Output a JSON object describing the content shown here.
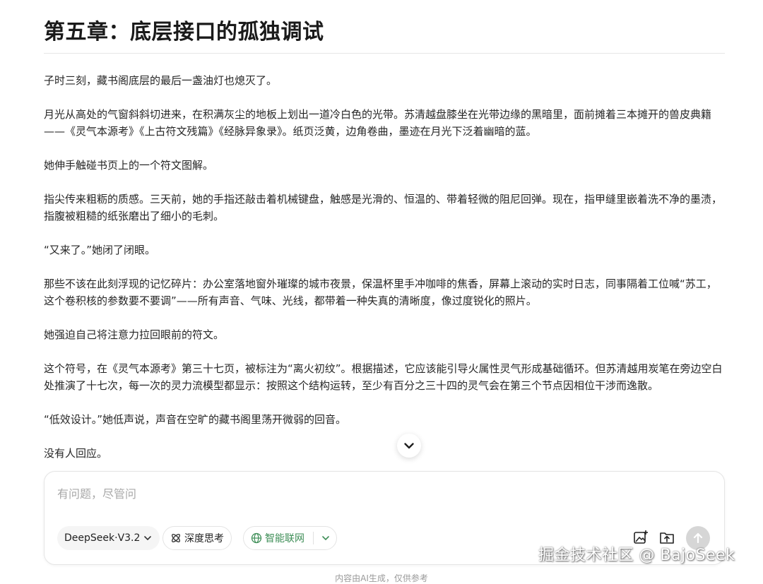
{
  "chapter": {
    "title": "第五章：底层接口的孤独调试",
    "paragraphs": [
      "子时三刻，藏书阁底层的最后一盏油灯也熄灭了。",
      "月光从高处的气窗斜斜切进来，在积满灰尘的地板上划出一道冷白色的光带。苏清越盘膝坐在光带边缘的黑暗里，面前摊着三本摊开的兽皮典籍——《灵气本源考》《上古符文残篇》《经脉异象录》。纸页泛黄，边角卷曲，墨迹在月光下泛着幽暗的蓝。",
      "她伸手触碰书页上的一个符文图解。",
      "指尖传来粗粝的质感。三天前，她的手指还敲击着机械键盘，触感是光滑的、恒温的、带着轻微的阻尼回弹。现在，指甲缝里嵌着洗不净的墨渍，指腹被粗糙的纸张磨出了细小的毛刺。",
      "“又来了。”她闭了闭眼。",
      "那些不该在此刻浮现的记忆碎片：办公室落地窗外璀璨的城市夜景，保温杯里手冲咖啡的焦香，屏幕上滚动的实时日志，同事隔着工位喊“苏工，这个卷积核的参数要不要调”——所有声音、气味、光线，都带着一种失真的清晰度，像过度锐化的照片。",
      "她强迫自己将注意力拉回眼前的符文。",
      "这个符号，在《灵气本源考》第三十七页，被标注为“离火初纹”。根据描述，它应该能引导火属性灵气形成基础循环。但苏清越用炭笔在旁边空白处推演了十七次，每一次的灵力流模型都显示：按照这个结构运转，至少有百分之三十四的灵气会在第三个节点因相位干涉而逸散。",
      "“低效设计。”她低声说，声音在空旷的藏书阁里荡开微弱的回音。",
      "没有人回应。"
    ]
  },
  "composer": {
    "placeholder": "有问题，尽管问",
    "model_label": "DeepSeek·V3.2",
    "deep_think_label": "深度思考",
    "web_search_label": "智能联网"
  },
  "watermark": "掘金技术社区 @ BajoSeek",
  "disclaimer": "内容由AI生成，仅供参考",
  "colors": {
    "accent_green": "#3e8e57",
    "send_disabled": "#d6d6d6"
  },
  "icons": {
    "scroll": "chevron-down-icon",
    "model_dropdown": "chevron-down-icon",
    "deep_think": "atom-icon",
    "web_search": "globe-icon",
    "image_upload": "image-plus-icon",
    "file_upload": "folder-upload-icon",
    "send": "arrow-up-icon"
  }
}
